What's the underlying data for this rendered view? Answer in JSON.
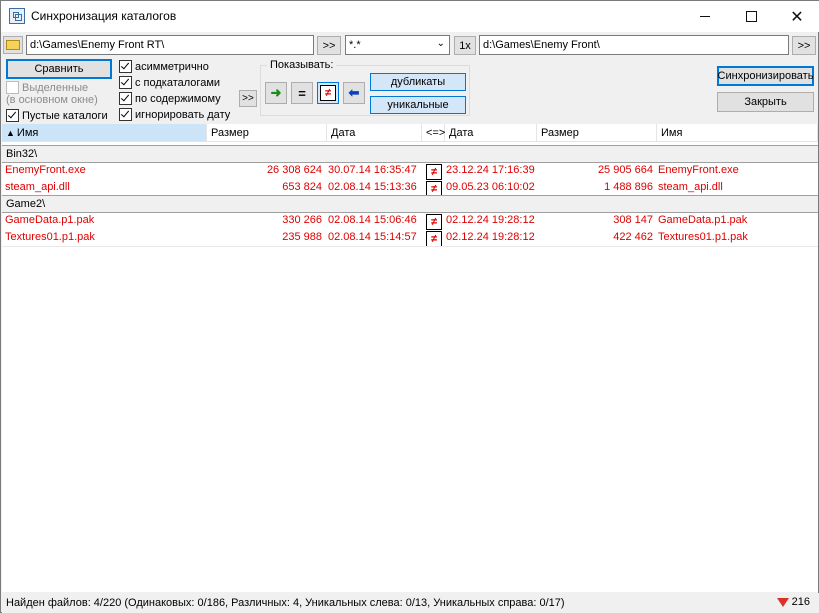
{
  "window": {
    "title": "Синхронизация каталогов"
  },
  "left_path": {
    "value": "d:\\Games\\Enemy Front RT\\",
    "browse_label": ">>"
  },
  "mask": {
    "value": "*.*"
  },
  "swap_label": "1x",
  "right_path": {
    "value": "d:\\Games\\Enemy Front\\",
    "browse_label": ">>"
  },
  "options": {
    "compare_label": "Сравнить",
    "selected_label": "Выделенные",
    "selected_sub": "(в основном окне)",
    "empty_dirs_label": "Пустые каталоги",
    "asymmetric_label": "асимметрично",
    "subdirs_label": "с подкаталогами",
    "by_content_label": "по содержимому",
    "ignore_date_label": "игнорировать дату",
    "more_label": ">>"
  },
  "show": {
    "label": "Показывать:",
    "dupes_label": "дубликаты",
    "unique_label": "уникальные"
  },
  "actions": {
    "sync_label": "Синхронизировать",
    "close_label": "Закрыть"
  },
  "columns": {
    "name_left": "Имя",
    "size_left": "Размер",
    "date_left": "Дата",
    "compare": "<=>",
    "date_right": "Дата",
    "size_right": "Размер",
    "name_right": "Имя"
  },
  "groups": [
    {
      "name": "Bin32\\",
      "rows": [
        {
          "lname": "EnemyFront.exe",
          "lsize": "26 308 624",
          "ldate": "30.07.14 16:35:47",
          "rdate": "23.12.24 17:16:39",
          "rsize": "25 905 664",
          "rname": "EnemyFront.exe"
        },
        {
          "lname": "steam_api.dll",
          "lsize": "653 824",
          "ldate": "02.08.14 15:13:36",
          "rdate": "09.05.23 06:10:02",
          "rsize": "1 488 896",
          "rname": "steam_api.dll"
        }
      ]
    },
    {
      "name": "Game2\\",
      "rows": [
        {
          "lname": "GameData.p1.pak",
          "lsize": "330 266",
          "ldate": "02.08.14 15:06:46",
          "rdate": "02.12.24 19:28:12",
          "rsize": "308 147",
          "rname": "GameData.p1.pak"
        },
        {
          "lname": "Textures01.p1.pak",
          "lsize": "235 988",
          "ldate": "02.08.14 15:14:57",
          "rdate": "02.12.24 19:28:12",
          "rsize": "422 462",
          "rname": "Textures01.p1.pak"
        }
      ]
    }
  ],
  "status": {
    "text": "Найден файлов: 4/220  (Одинаковых: 0/186, Различных: 4, Уникальных слева: 0/13, Уникальных справа: 0/17)",
    "count": "216"
  },
  "colors": {
    "diff_text": "#e00000",
    "accent": "#0078d7",
    "toggle_bg": "#d4e7f9"
  }
}
